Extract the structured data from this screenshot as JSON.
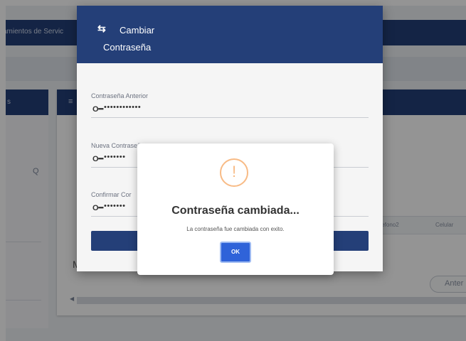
{
  "background": {
    "topbar_title": "amientos de Servic",
    "left_panel_title": "s",
    "left_search_icon": "Q",
    "card_header_icon": "≡",
    "table_columns": [
      "Telefono2",
      "Celular"
    ],
    "m_letter": "M",
    "anterior_button": "Anter"
  },
  "modal": {
    "icon": "⇆",
    "title_line1": "Cambiar",
    "title_line2": "Contraseña",
    "fields": [
      {
        "label": "Contraseña Anterior",
        "value": "••••••••••••"
      },
      {
        "label": "Nueva Contraseña",
        "value": "•••••••"
      },
      {
        "label": "Confirmar Cor",
        "value": "•••••••"
      }
    ]
  },
  "alert": {
    "icon": "!",
    "title": "Contraseña cambiada...",
    "text": "La contraseña fue cambiada con exito.",
    "ok_label": "OK"
  },
  "colors": {
    "header_blue": "#243f78",
    "warning": "#f8bb86",
    "ok_button": "#2f63d9"
  }
}
